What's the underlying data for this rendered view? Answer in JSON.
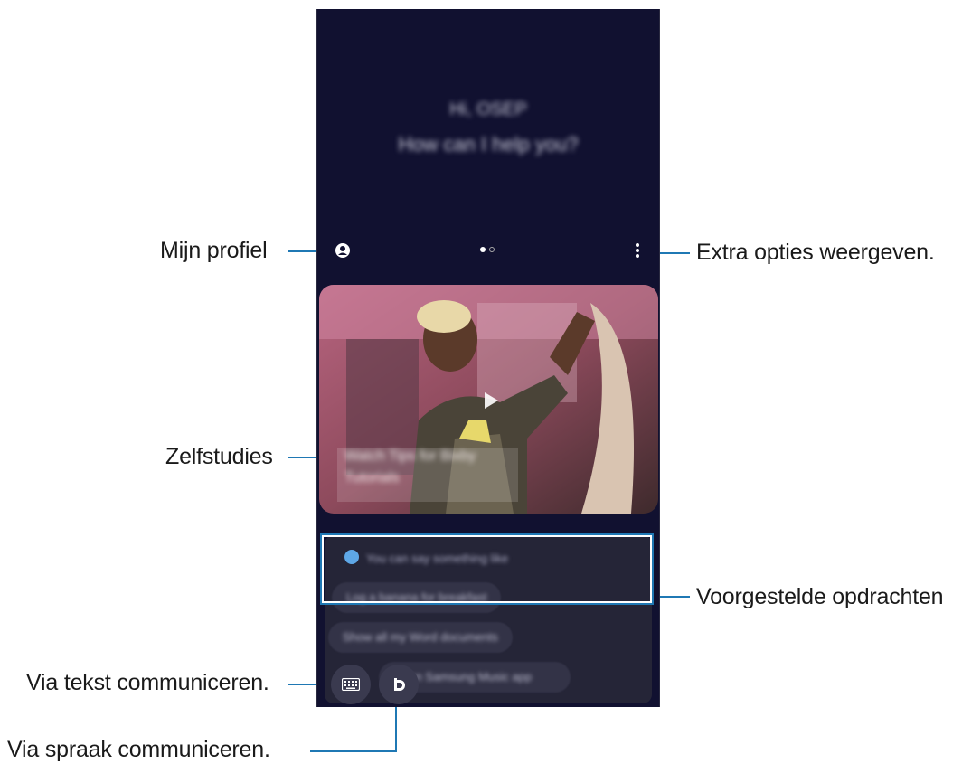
{
  "callouts": {
    "profile": "Mijn profiel",
    "more_options": "Extra opties weergeven.",
    "tutorials": "Zelfstudies",
    "suggested": "Voorgestelde opdrachten",
    "text": "Via tekst communiceren.",
    "voice": "Via spraak communiceren."
  },
  "screen": {
    "greeting_line1": "Hi, OSEP",
    "greeting_line2": "How can I help you?",
    "tutorial_title": "Watch Tips for Bixby",
    "tutorial_sub": "Tutorials",
    "hint": "You can say something like",
    "chips": [
      "Log a banana for breakfast",
      "Show all my Word documents",
      "Open Samsung Music app"
    ]
  },
  "colors": {
    "callout_line": "#1f78b4",
    "screen_bg": "#111130",
    "panel_bg": "#252537"
  },
  "icons": [
    "profile-icon",
    "more-options-icon",
    "play-icon",
    "keyboard-icon",
    "bixby-icon"
  ]
}
